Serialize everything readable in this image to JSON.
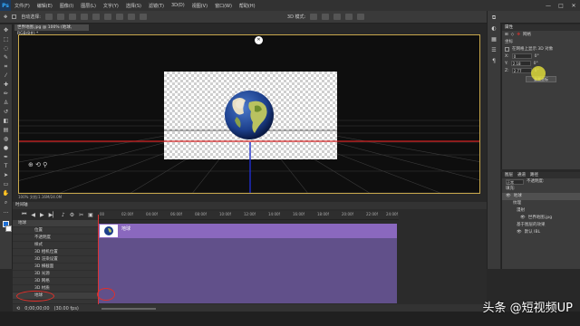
{
  "app": {
    "logo": "Ps",
    "menus": [
      "文件(F)",
      "编辑(E)",
      "图像(I)",
      "图层(L)",
      "文字(Y)",
      "选择(S)",
      "滤镜(T)",
      "3D(D)",
      "视图(V)",
      "窗口(W)",
      "帮助(H)"
    ],
    "window_controls": [
      "—",
      "□",
      "✕"
    ]
  },
  "options_bar": {
    "auto_select": "自动选择:",
    "mode_3d": "3D 模式:"
  },
  "document": {
    "tab_title": "世界地图.jpg @ 100% (地球, RGB/8#) *",
    "close_glyph": "✕",
    "status": "100%   文档:1.16M/24.0M"
  },
  "properties": {
    "tabs": [
      "属性"
    ],
    "section": "3D",
    "label_coord": "坐标",
    "label_mesh": "网格",
    "snap": "在网格上显示 3D 对象",
    "x_label": "X:",
    "x_val": "0",
    "y_label": "Y:",
    "y_val": "2.18",
    "z_label": "Z:",
    "z_val": "2.77",
    "deg1": "0°",
    "deg2": "0°",
    "deg3": "0°",
    "reset_button": "重置坐标"
  },
  "layers": {
    "tabs": [
      "图层",
      "通道",
      "路径"
    ],
    "filter": "正常",
    "opacity": "不透明度:",
    "fill": "填充:",
    "items": [
      "地球",
      "纹理",
      "漫射",
      "世界地图.jpg",
      "基于图层的效果",
      "默认 IBL"
    ]
  },
  "timeline": {
    "title": "时间轴",
    "ruler": [
      "00",
      "02:00f",
      "04:00f",
      "06:00f",
      "08:00f",
      "10:00f",
      "12:00f",
      "14:00f",
      "16:00f",
      "18:00f",
      "20:00f",
      "22:00f",
      "24:00f"
    ],
    "track_rows": [
      "地球",
      "位置",
      "不透明度",
      "样式",
      "3D 相机位置",
      "3D 渲染设置",
      "3D 横截面",
      "3D 光源",
      "3D 网格",
      "3D 材质",
      "地球"
    ],
    "clip_label": "地球",
    "time": "0;00;00;00",
    "fps": "(30.00 fps)"
  },
  "watermark": "头条 @短视频UP"
}
